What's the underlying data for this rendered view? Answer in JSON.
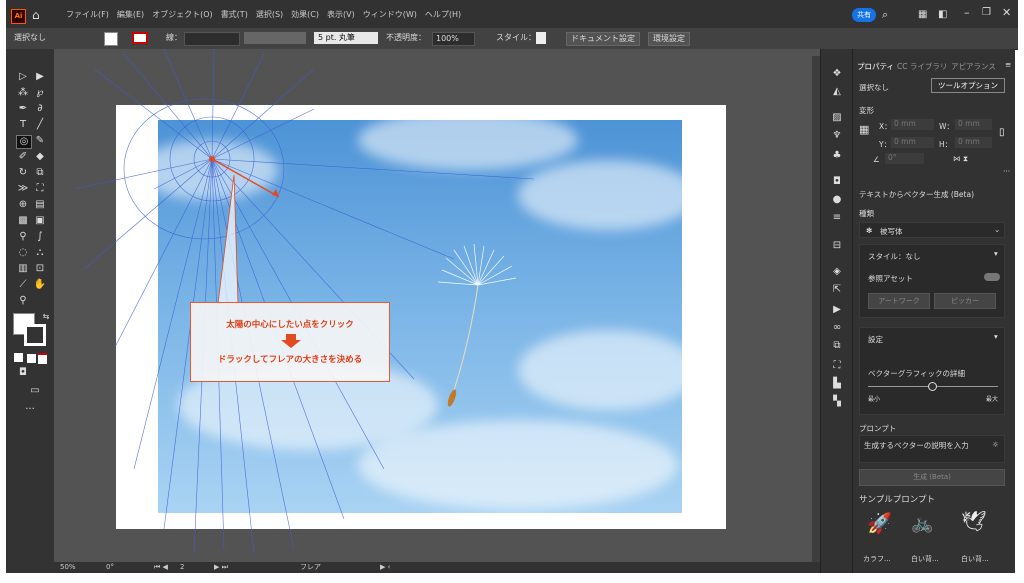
{
  "menubar": {
    "logo": "Ai",
    "items": [
      "ファイル(F)",
      "編集(E)",
      "オブジェクト(O)",
      "書式(T)",
      "選択(S)",
      "効果(C)",
      "表示(V)",
      "ウィンドウ(W)",
      "ヘルプ(H)"
    ],
    "share": "共有"
  },
  "controlbar": {
    "selection": "選択なし",
    "stroke_label": "線：",
    "brush": "5 pt. 丸筆",
    "opacity_label": "不透明度：",
    "opacity": "100%",
    "style_label": "スタイル：",
    "doc_setup": "ドキュメント設定",
    "prefs": "環境設定"
  },
  "callout": {
    "line1": "太陽の中心にしたい点をクリック",
    "line2": "ドラックしてフレアの大きさを決める"
  },
  "statusbar": {
    "zoom": "50%",
    "rotate": "0°",
    "page": "2",
    "tool": "フレア"
  },
  "panel": {
    "tabs": [
      "プロパティ",
      "CC ライブラリ",
      "アピアランス"
    ],
    "selection": "選択なし",
    "tool_options": "ツールオプション",
    "transform": "変形",
    "x_label": "X：",
    "y_label": "Y：",
    "w_label": "W：",
    "h_label": "H：",
    "x_val": "0 mm",
    "y_val": "0 mm",
    "w_val": "0 mm",
    "h_val": "0 mm",
    "angle_val": "0°",
    "text_to_vector": "テキストからベクター生成 (Beta)",
    "type_label": "種類",
    "type_value": "被写体",
    "style_label": "スタイル：なし",
    "reference_asset": "参照アセット",
    "artwork": "アートワーク",
    "picker": "ピッカー",
    "settings": "設定",
    "detail_label": "ベクターグラフィックの詳細",
    "min_label": "最小",
    "max_label": "最大",
    "prompt_label": "プロンプト",
    "prompt_placeholder": "生成するベクターの説明を入力",
    "generate": "生成 (Beta)",
    "samples_label": "サンプルプロンプト",
    "samples": [
      "カラフ...",
      "白い背...",
      "白い背..."
    ]
  },
  "colors": {
    "accent": "#1473e6",
    "callout": "#e85a30",
    "sky": "#78b3e6"
  }
}
